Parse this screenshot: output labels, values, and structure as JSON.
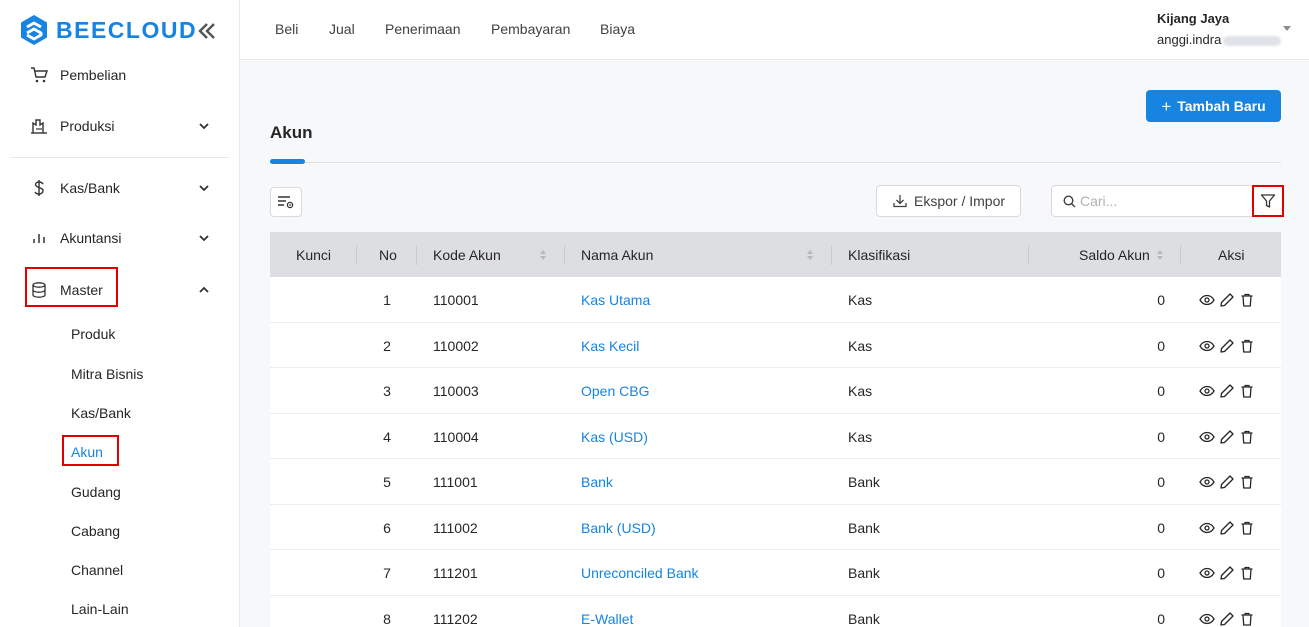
{
  "brand": {
    "name": "BEECLOUD",
    "color": "#1684e0"
  },
  "sidebar": {
    "items": [
      {
        "label": "Pembelian",
        "icon": "cart-icon"
      },
      {
        "label": "Produksi",
        "icon": "factory-icon"
      },
      {
        "label": "Kas/Bank",
        "icon": "dollar-icon"
      },
      {
        "label": "Akuntansi",
        "icon": "bar-chart-icon"
      },
      {
        "label": "Master",
        "icon": "database-icon"
      }
    ],
    "master_sub": [
      "Produk",
      "Mitra Bisnis",
      "Kas/Bank",
      "Akun",
      "Gudang",
      "Cabang",
      "Channel",
      "Lain-Lain"
    ],
    "active_sub": "Akun"
  },
  "topnav": {
    "items": [
      "Beli",
      "Jual",
      "Penerimaan",
      "Pembayaran",
      "Biaya"
    ],
    "company": "Kijang Jaya",
    "user": "anggi.indra"
  },
  "page": {
    "title": "Akun",
    "add_button": "Tambah Baru",
    "export_button": "Ekspor / Impor",
    "search_placeholder": "Cari..."
  },
  "table": {
    "headers": [
      "Kunci",
      "No",
      "Kode Akun",
      "Nama Akun",
      "Klasifikasi",
      "Saldo Akun",
      "Aksi"
    ],
    "rows": [
      {
        "no": "1",
        "kode": "110001",
        "nama": "Kas Utama",
        "klasifikasi": "Kas",
        "saldo": "0"
      },
      {
        "no": "2",
        "kode": "110002",
        "nama": "Kas Kecil",
        "klasifikasi": "Kas",
        "saldo": "0"
      },
      {
        "no": "3",
        "kode": "110003",
        "nama": "Open CBG",
        "klasifikasi": "Kas",
        "saldo": "0"
      },
      {
        "no": "4",
        "kode": "110004",
        "nama": "Kas (USD)",
        "klasifikasi": "Kas",
        "saldo": "0"
      },
      {
        "no": "5",
        "kode": "111001",
        "nama": "Bank",
        "klasifikasi": "Bank",
        "saldo": "0"
      },
      {
        "no": "6",
        "kode": "111002",
        "nama": "Bank (USD)",
        "klasifikasi": "Bank",
        "saldo": "0"
      },
      {
        "no": "7",
        "kode": "111201",
        "nama": "Unreconciled Bank",
        "klasifikasi": "Bank",
        "saldo": "0"
      },
      {
        "no": "8",
        "kode": "111202",
        "nama": "E-Wallet",
        "klasifikasi": "Bank",
        "saldo": "0"
      }
    ]
  },
  "colors": {
    "accent": "#1684e0",
    "highlight": "#e00000",
    "header_bg": "#dcdee2"
  }
}
